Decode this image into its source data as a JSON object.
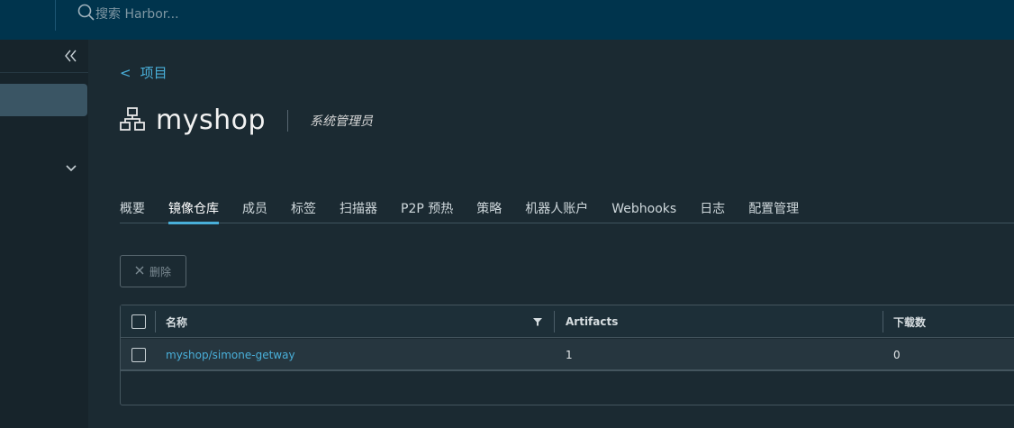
{
  "search": {
    "placeholder": "搜索 Harbor..."
  },
  "breadcrumb": {
    "arrow": "<",
    "label": "项目"
  },
  "project": {
    "name": "myshop",
    "role": "系统管理员"
  },
  "tabs": [
    {
      "label": "概要"
    },
    {
      "label": "镜像仓库"
    },
    {
      "label": "成员"
    },
    {
      "label": "标签"
    },
    {
      "label": "扫描器"
    },
    {
      "label": "P2P 预热"
    },
    {
      "label": "策略"
    },
    {
      "label": "机器人账户"
    },
    {
      "label": "Webhooks"
    },
    {
      "label": "日志"
    },
    {
      "label": "配置管理"
    }
  ],
  "active_tab": "镜像仓库",
  "toolbar": {
    "delete_label": "删除"
  },
  "table": {
    "columns": [
      "名称",
      "Artifacts",
      "下载数"
    ],
    "rows": [
      {
        "name": "myshop/simone-getway",
        "artifacts": "1",
        "pulls": "0"
      }
    ]
  },
  "colors": {
    "accent": "#49afd9",
    "header": "#00344d",
    "background": "#1b2a32"
  },
  "icons": [
    "search-icon",
    "collapse-sidebar-icon",
    "chevron-down-icon",
    "project-icon",
    "close-icon",
    "filter-icon"
  ]
}
